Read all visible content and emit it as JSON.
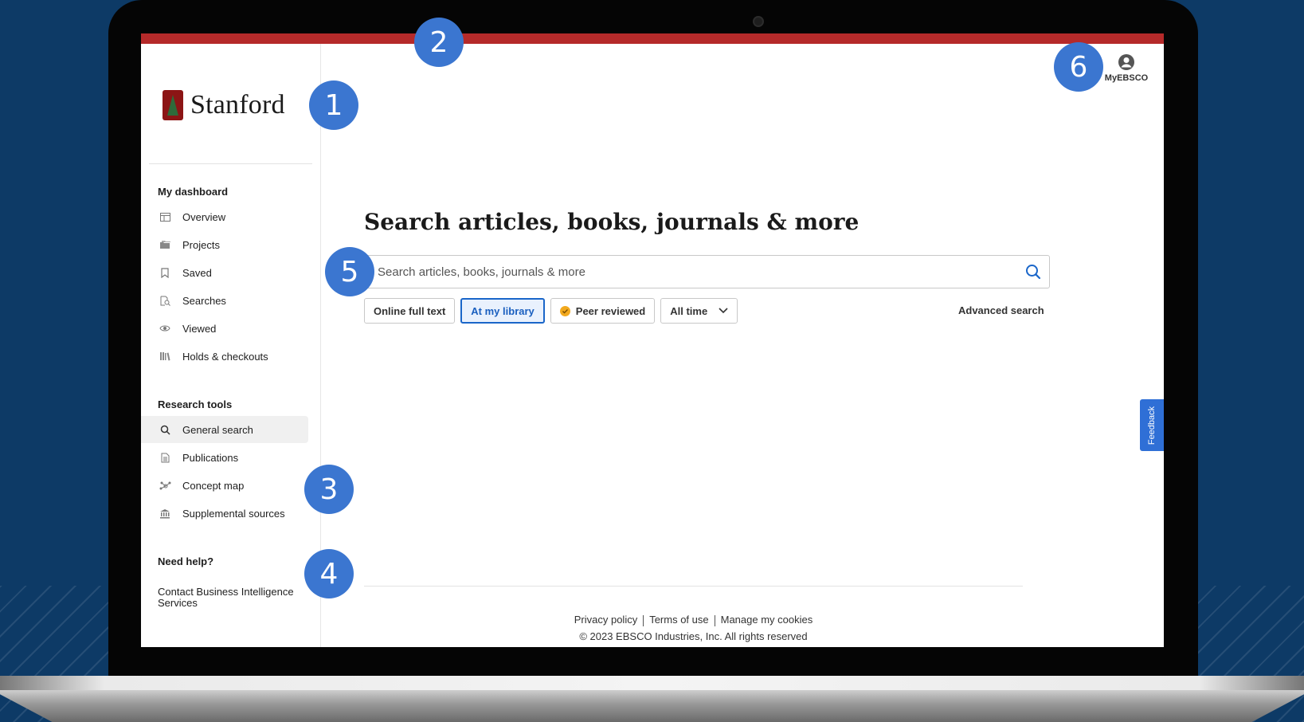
{
  "app": {
    "logo_text": "Stanford",
    "colors": {
      "accent": "#b52a2a",
      "primary": "#1a66c9",
      "callout": "#3b76d0",
      "background": "#0d3a66"
    }
  },
  "sidebar": {
    "dashboard_heading": "My dashboard",
    "dashboard_items": [
      {
        "label": "Overview",
        "icon": "overview-icon"
      },
      {
        "label": "Projects",
        "icon": "folder-icon"
      },
      {
        "label": "Saved",
        "icon": "bookmark-icon"
      },
      {
        "label": "Searches",
        "icon": "search-history-icon"
      },
      {
        "label": "Viewed",
        "icon": "eye-icon"
      },
      {
        "label": "Holds & checkouts",
        "icon": "books-icon"
      }
    ],
    "tools_heading": "Research tools",
    "tools_items": [
      {
        "label": "General search",
        "icon": "search-icon",
        "active": true
      },
      {
        "label": "Publications",
        "icon": "document-icon"
      },
      {
        "label": "Concept map",
        "icon": "concept-map-icon"
      },
      {
        "label": "Supplemental sources",
        "icon": "institution-icon"
      }
    ],
    "help_heading": "Need help?",
    "help_link": "Contact Business Intelligence Services"
  },
  "header": {
    "account_label": "MyEBSCO"
  },
  "search": {
    "heading": "Search articles, books, journals & more",
    "placeholder": "Search articles, books, journals & more",
    "value": "",
    "filters": {
      "online_full_text": "Online full text",
      "at_my_library": "At my library",
      "peer_reviewed": "Peer reviewed",
      "date_range": "All time"
    },
    "advanced_label": "Advanced search"
  },
  "footer": {
    "privacy": "Privacy policy",
    "terms": "Terms of use",
    "cookies": "Manage my cookies",
    "copyright": "© 2023 EBSCO Industries, Inc. All rights reserved"
  },
  "feedback_label": "Feedback",
  "callouts": [
    "1",
    "2",
    "3",
    "4",
    "5",
    "6"
  ]
}
